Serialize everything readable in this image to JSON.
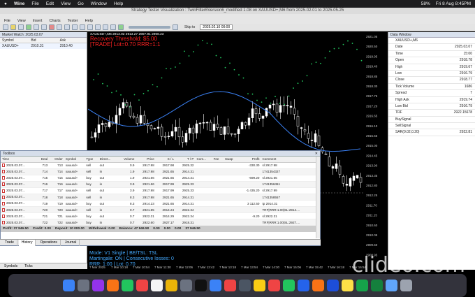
{
  "menubar": {
    "apple": "",
    "app": "Wine",
    "items": [
      "File",
      "Edit",
      "View",
      "Go",
      "Window",
      "Help"
    ],
    "battery": "58%",
    "clock": "Fri 8 Aug  8:45PM"
  },
  "window": {
    "title": "Strategy Tester Visualization : TwinFilter6Version6_modified 1.08 on XAUUSD+,M6 from 2025.02.01 to 2025.05.25",
    "menu": [
      "File",
      "View",
      "Insert",
      "Charts",
      "Tester",
      "Help"
    ]
  },
  "toolbar": {
    "skip_to": "Skip to",
    "skip_date": "2025.02.10 00:00"
  },
  "market_watch": {
    "title": "Market Watch: 2025.03.07",
    "cols": [
      "Symbol",
      "Bid",
      "Ask"
    ],
    "row": {
      "symbol": "XAUUSD+",
      "bid": "2910.31",
      "ask": "2910.40"
    },
    "tabs": [
      "Symbols",
      "Ticks"
    ]
  },
  "chart": {
    "symbol": "XAUUSD+,M6",
    "ohlc": "XAUUSD+,M6  2913.02 2913.27 2907.91 2908.23",
    "line2": "Recovery Threshold: $5.00",
    "line3": "[TRADE] Lot=0.70 RRR=1:1",
    "bottom1": "Mode: V1 Single | BE/TSL: TSL",
    "bottom2": "Martingale: ON | Consecutive losses: 0",
    "bottom3": "RRR: 1:00 | Lot: 0.70",
    "price_labels": [
      "2921.05",
      "2920.50",
      "2919.95",
      "2919.40",
      "2918.85",
      "2918.30",
      "2917.75",
      "2917.20",
      "2916.65",
      "2916.10",
      "2915.55",
      "2915.00",
      "2914.45",
      "2913.90",
      "2913.35",
      "2912.80",
      "2912.25",
      "2911.70",
      "2911.15",
      "2910.60",
      "2910.05",
      "2909.50",
      "2908.95"
    ],
    "time_labels": [
      "7 Mar 2025",
      "7 Mar 10:18",
      "7 Mar 10:54",
      "7 Mar 11:30",
      "7 Mar 12:06",
      "7 Mar 12:42",
      "7 Mar 13:18",
      "7 Mar 13:54",
      "7 Mar 14:30",
      "7 Mar 15:06",
      "7 Mar 15:42",
      "7 Mar 16:18",
      "7 Mar 16:54"
    ]
  },
  "data_window": {
    "title": "Data Window",
    "symbol": "XAUUSD+,M6",
    "rows": [
      {
        "k": "Date",
        "v": "2025.03.07"
      },
      {
        "k": "Time",
        "v": "15:00"
      },
      {
        "k": "Open",
        "v": "2918.78"
      },
      {
        "k": "High",
        "v": "2919.67"
      },
      {
        "k": "Low",
        "v": "2916.79"
      },
      {
        "k": "Close",
        "v": "2918.77"
      },
      {
        "k": "Tick Volume",
        "v": "1686"
      },
      {
        "k": "Spread",
        "v": "7"
      },
      {
        "k": "High Ask",
        "v": "2919.74"
      },
      {
        "k": "Low Bid",
        "v": "2916.79"
      },
      {
        "k": "TRF",
        "v": "2922.15678"
      },
      {
        "k": "BuySignal",
        "v": ""
      },
      {
        "k": "SellSignal",
        "v": ""
      },
      {
        "k": "SAR(0.02,0.20)",
        "v": "2922.81"
      }
    ]
  },
  "toolbox": {
    "title": "Toolbox",
    "cols": [
      "Time",
      "Deal",
      "Order",
      "Symbol",
      "Type",
      "Direct...",
      "Volume",
      "Price",
      "S / L",
      "T / P",
      "Com...",
      "Fee",
      "Swap",
      "Profit",
      "Comment"
    ],
    "rows": [
      [
        "2025.03.07...",
        "713",
        "713",
        "xauusd+",
        "sell",
        "out",
        "0.9",
        "2917.98",
        "2917.98",
        "2925.32",
        "",
        "",
        "",
        "-330.30",
        "sl 2917.98"
      ],
      [
        "2025.03.07...",
        "714",
        "714",
        "xauusd+",
        "sell",
        "in",
        "1.9",
        "2917.98",
        "2921.65",
        "2914.31",
        "",
        "",
        "",
        "",
        "1741354327"
      ],
      [
        "2025.03.07...",
        "715",
        "715",
        "xauusd+",
        "buy",
        "out",
        "1.9",
        "2921.66",
        "2921.65",
        "2914.31",
        "",
        "",
        "",
        "-699.20",
        "sl 2921.65"
      ],
      [
        "2025.03.07...",
        "716",
        "716",
        "xauusd+",
        "buy",
        "in",
        "3.9",
        "2921.66",
        "2917.99",
        "2925.33",
        "",
        "",
        "",
        "",
        "1741356451"
      ],
      [
        "2025.03.07...",
        "717",
        "717",
        "xauusd+",
        "sell",
        "out",
        "3.9",
        "2917.98",
        "2917.99",
        "2925.33",
        "",
        "",
        "",
        "-1 435.20",
        "sl 2917.99"
      ],
      [
        "2025.03.07...",
        "718",
        "718",
        "xauusd+",
        "sell",
        "in",
        "8.3",
        "2917.98",
        "2921.65",
        "2914.31",
        "",
        "",
        "",
        "",
        "1741358557"
      ],
      [
        "2025.03.07...",
        "719",
        "719",
        "xauusd+",
        "buy",
        "out",
        "8.3",
        "2914.23",
        "2921.65",
        "2914.31",
        "",
        "",
        "",
        "3 112.50",
        "tp 2914.31"
      ],
      [
        "2025.03.07...",
        "720",
        "720",
        "xauusd+",
        "sell",
        "in",
        "0.7",
        "2921.85",
        "2914.24",
        "2922.34",
        "",
        "",
        "",
        "",
        "TRF|RRR:1.00|SL:2914...."
      ],
      [
        "2025.03.07...",
        "721",
        "721",
        "xauusd+",
        "buy",
        "out",
        "0.7",
        "2922.31",
        "2914.29",
        "2922.34",
        "",
        "",
        "",
        "-9.20",
        "sl 2922.31"
      ],
      [
        "2025.03.07...",
        "722",
        "722",
        "xauusd+",
        "buy",
        "in",
        "0.7",
        "2922.60",
        "2927.17",
        "2918.31",
        "",
        "",
        "",
        "",
        "TRF|RRR:1.00|SL:2927...."
      ]
    ],
    "summary": [
      "Profit: 37 946.50",
      "Credit: 0.00",
      "Deposit: 10 000.00",
      "Withdrawal: 0.00",
      "Balance: 47 946.50",
      "0.00",
      "0.00",
      "0.00",
      "37 946.50"
    ],
    "tabs": [
      "Trade",
      "History",
      "Operations",
      "Journal"
    ]
  },
  "dock": {
    "watermark": "clideo.com",
    "icons": [
      "finder-icon",
      "launchpad-icon",
      "apps-icon",
      "firefox-icon",
      "messages-icon",
      "brave-icon",
      "calendar-icon",
      "photos-icon",
      "settings-icon",
      "terminal-icon",
      "share-icon",
      "chrome-icon",
      "calculator-icon",
      "notes-icon",
      "chrome2-icon",
      "whatsapp-icon",
      "vscode-icon",
      "firefox2-icon",
      "word-icon",
      "sticky-icon",
      "drive-icon",
      "excel-icon",
      "preview-icon",
      "trash-icon"
    ],
    "date_badge": "8"
  }
}
